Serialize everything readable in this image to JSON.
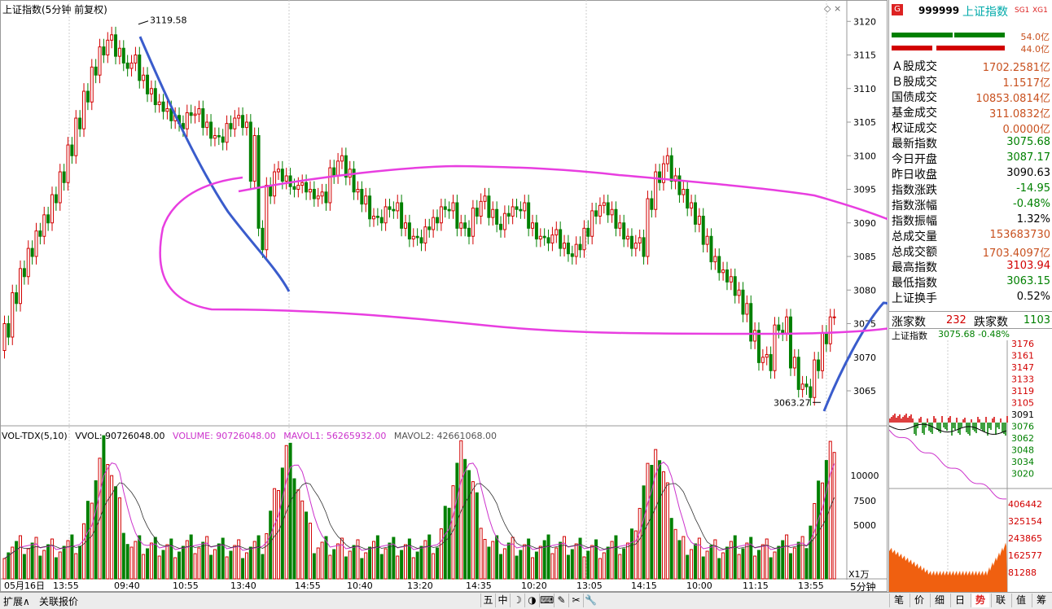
{
  "main": {
    "title": "上证指数(5分钟 前复权)",
    "price_ticks": [
      "3120",
      "3115",
      "3110",
      "3105",
      "3100",
      "3095",
      "3090",
      "3085",
      "3080",
      "3075",
      "3070",
      "3065"
    ],
    "time_ticks": [
      "05月16日",
      "13:55",
      "09:40",
      "10:55",
      "13:40",
      "14:55",
      "10:40",
      "13:20",
      "14:35",
      "10:20",
      "13:05",
      "14:15",
      "10:00",
      "11:15",
      "13:55"
    ],
    "high_label": "3119.58",
    "low_label": "3063.27",
    "period_label": "5分钟",
    "volume_ticks": [
      "10000",
      "7500",
      "5000"
    ],
    "volume_unit": "X1万"
  },
  "volume_header": {
    "name": "VOL-TDX(5,10)",
    "vvol": "VVOL: 90726048.00",
    "volume": "VOLUME: 90726048.00",
    "mavol1": "MAVOL1: 56265932.00",
    "mavol2": "MAVOL2: 42661068.00"
  },
  "panel": {
    "code": "999999",
    "name": "上证指数",
    "sg": "SG1",
    "xg": "XG1",
    "badge": "G",
    "bar_top_value": "54.0亿",
    "bar_bottom_value": "44.0亿",
    "rows": [
      {
        "label": "Ａ股成交",
        "value": "1702.2581亿",
        "color": "#c8501e"
      },
      {
        "label": "Ｂ股成交",
        "value": "1.1517亿",
        "color": "#c8501e"
      },
      {
        "label": "国债成交",
        "value": "10853.0814亿",
        "color": "#c8501e"
      },
      {
        "label": "基金成交",
        "value": "311.0832亿",
        "color": "#c8501e"
      },
      {
        "label": "权证成交",
        "value": "0.0000亿",
        "color": "#c8501e"
      },
      {
        "label": "最新指数",
        "value": "3075.68",
        "color": "#008000"
      },
      {
        "label": "今日开盘",
        "value": "3087.17",
        "color": "#008000"
      },
      {
        "label": "昨日收盘",
        "value": "3090.63",
        "color": "#000000"
      },
      {
        "label": "指数涨跌",
        "value": "-14.95",
        "color": "#008000"
      },
      {
        "label": "指数涨幅",
        "value": "-0.48%",
        "color": "#008000"
      },
      {
        "label": "指数振幅",
        "value": "1.32%",
        "color": "#000000"
      },
      {
        "label": "总成交量",
        "value": "153683730",
        "color": "#c8501e"
      },
      {
        "label": "总成交额",
        "value": "1703.4097亿",
        "color": "#c8501e"
      },
      {
        "label": "最高指数",
        "value": "3103.94",
        "color": "#d20000"
      },
      {
        "label": "最低指数",
        "value": "3063.15",
        "color": "#008000"
      },
      {
        "label": "上证换手",
        "value": "0.52%",
        "color": "#000000"
      }
    ],
    "up_label": "涨家数",
    "up_value": "232",
    "down_label": "跌家数",
    "down_value": "1103",
    "mini_title": "上证指数",
    "mini_value": "3075.68 -0.48%",
    "mini_price_ticks": [
      "3176",
      "3161",
      "3147",
      "3133",
      "3119",
      "3105",
      "3091",
      "3076",
      "3062",
      "3048",
      "3034",
      "3020"
    ],
    "mini_vol_ticks": [
      "406442",
      "325154",
      "243865",
      "162577",
      "81288"
    ]
  },
  "bottom_tabs": {
    "left": [
      "扩展∧",
      "关联报价"
    ],
    "center": [
      "五",
      "中",
      "☽",
      "◑",
      "⌨",
      "✎",
      "✂",
      "🔧"
    ],
    "right": [
      "笔",
      "价",
      "细",
      "日",
      "势",
      "联",
      "值",
      "筹"
    ],
    "active_right": "势"
  },
  "chart_data": {
    "type": "candlestick",
    "title": "上证指数(5分钟 前复权)",
    "ylim": [
      3061,
      3121
    ],
    "high": 3119.58,
    "low": 3063.27,
    "x_tick_labels": [
      "05月16日",
      "13:55",
      "09:40",
      "10:55",
      "13:40",
      "14:55",
      "10:40",
      "13:20",
      "14:35",
      "10:20",
      "13:05",
      "14:15",
      "10:00",
      "11:15",
      "13:55"
    ],
    "close_path": [
      3073,
      3078,
      3082,
      3085,
      3088,
      3090,
      3093,
      3096,
      3100,
      3104,
      3108,
      3112,
      3115,
      3118,
      3116,
      3113,
      3115,
      3112,
      3110,
      3108,
      3107,
      3106,
      3104,
      3106,
      3107,
      3105,
      3103,
      3102,
      3104,
      3106,
      3105,
      3103,
      3086,
      3094,
      3098,
      3097,
      3095,
      3096,
      3095,
      3094,
      3093,
      3097,
      3100,
      3098,
      3095,
      3094,
      3091,
      3090,
      3092,
      3093,
      3090,
      3088,
      3087,
      3089,
      3090,
      3092,
      3093,
      3090,
      3088,
      3091,
      3094,
      3092,
      3089,
      3091,
      3092,
      3093,
      3090,
      3088,
      3087,
      3089,
      3087,
      3085,
      3086,
      3088,
      3091,
      3093,
      3092,
      3090,
      3088,
      3087,
      3085,
      3092,
      3096,
      3100,
      3097,
      3095,
      3093,
      3091,
      3088,
      3085,
      3083,
      3082,
      3080,
      3078,
      3074,
      3070,
      3068,
      3074,
      3076,
      3070,
      3066,
      3064,
      3068,
      3072,
      3076
    ]
  }
}
